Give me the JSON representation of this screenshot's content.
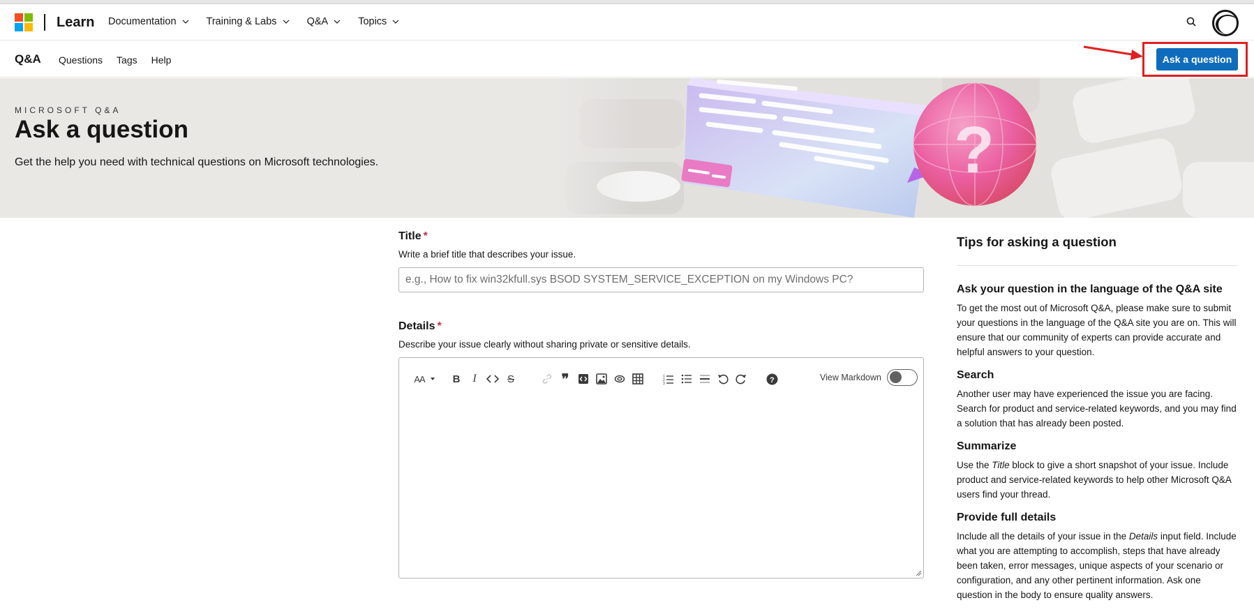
{
  "brand": {
    "name": "Learn",
    "logo_colors": [
      "#f25022",
      "#7fba00",
      "#00a4ef",
      "#ffb900"
    ]
  },
  "global_nav": {
    "items": [
      {
        "label": "Documentation"
      },
      {
        "label": "Training & Labs"
      },
      {
        "label": "Q&A"
      },
      {
        "label": "Topics"
      }
    ],
    "search_icon": "search-icon",
    "avatar_icon": "avatar"
  },
  "local_nav": {
    "title": "Q&A",
    "links": [
      {
        "label": "Questions"
      },
      {
        "label": "Tags"
      },
      {
        "label": "Help"
      }
    ],
    "ask_button": "Ask a question",
    "accent_color": "#0f6cbd",
    "annotation_color": "#e02020"
  },
  "hero": {
    "eyebrow": "MICROSOFT Q&A",
    "title": "Ask a question",
    "subtitle": "Get the help you need with technical questions on Microsoft technologies."
  },
  "form": {
    "title_label": "Title",
    "required_mark": "*",
    "title_desc": "Write a brief title that describes your issue.",
    "title_placeholder": "e.g., How to fix win32kfull.sys BSOD SYSTEM_SERVICE_EXCEPTION on my Windows PC?",
    "title_value": "",
    "details_label": "Details",
    "details_desc": "Describe your issue clearly without sharing private or sensitive details.",
    "details_value": "",
    "toolbar": {
      "font_size_glyph": "AA",
      "buttons": [
        "text-size-icon",
        "bold-icon",
        "italic-icon",
        "code-icon",
        "strikethrough-icon",
        "link-icon",
        "quote-icon",
        "code-block-icon",
        "image-icon",
        "attachment-icon",
        "table-icon",
        "numbered-list-icon",
        "bullet-list-icon",
        "horizontal-rule-icon",
        "undo-icon",
        "redo-icon",
        "help-icon"
      ],
      "view_markdown_label": "View Markdown",
      "view_markdown_on": false
    }
  },
  "tips": {
    "title": "Tips for asking a question",
    "sections": [
      {
        "heading": "Ask your question in the language of the Q&A site",
        "body": "To get the most out of Microsoft Q&A, please make sure to submit your questions in the language of the Q&A site you are on. This will ensure that our community of experts can provide accurate and helpful answers to your question."
      },
      {
        "heading": "Search",
        "body": "Another user may have experienced the issue you are facing. Search for product and service-related keywords, and you may find a solution that has already been posted."
      },
      {
        "heading": "Summarize",
        "body_pre": "Use the ",
        "body_em": "Title",
        "body_post": " block to give a short snapshot of your issue. Include product and service-related keywords to help other Microsoft Q&A users find your thread."
      },
      {
        "heading": "Provide full details",
        "body_pre": "Include all the details of your issue in the ",
        "body_em": "Details",
        "body_post": " input field. Include what you are attempting to accomplish, steps that have already been taken, error messages, unique aspects of your scenario or configuration, and any other pertinent information. Ask one question in the body to ensure quality answers."
      }
    ]
  }
}
